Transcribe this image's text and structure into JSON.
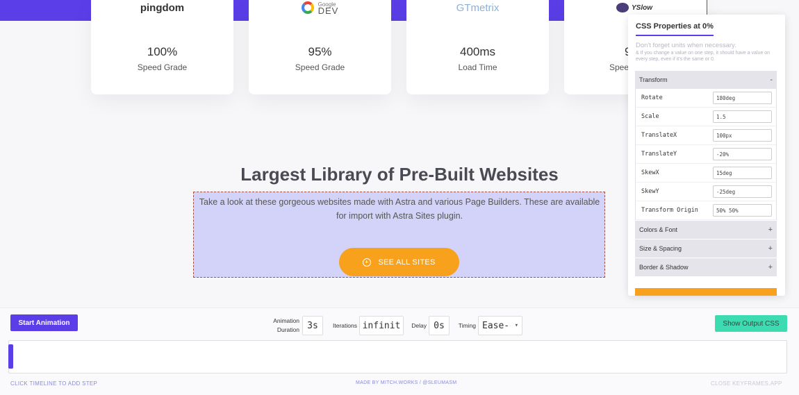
{
  "cards": [
    {
      "logo": "pingdom",
      "value": "100%",
      "label": "Speed Grade"
    },
    {
      "logo_small": "Google",
      "logo": "DEV",
      "value": "95%",
      "label": "Speed Grade"
    },
    {
      "logo": "GTmetrix",
      "value": "400ms",
      "label": "Load Time"
    },
    {
      "logo": "YSlow",
      "value": "9",
      "label": "Spee"
    }
  ],
  "section": {
    "title": "Largest Library of Pre-Built Websites",
    "description": "Take a look at these gorgeous websites made with Astra and various Page Builders. These are available for import with Astra Sites plugin.",
    "button_label": "SEE ALL SITES"
  },
  "panel": {
    "title": "CSS Properties at 0%",
    "hint": "Don't forget units when necessary.",
    "note": "& If you change a value on one step, it should have a value on every step, even if it's the same or 0.",
    "transform_header": "Transform",
    "transform_sign": "-",
    "properties": [
      {
        "name": "Rotate",
        "value": "180deg"
      },
      {
        "name": "Scale",
        "value": "1.5"
      },
      {
        "name": "TranslateX",
        "value": "100px"
      },
      {
        "name": "TranslateY",
        "value": "-20%"
      },
      {
        "name": "SkewX",
        "value": "15deg"
      },
      {
        "name": "SkewY",
        "value": "-25deg"
      },
      {
        "name": "Transform Origin",
        "value": "50% 50%"
      }
    ],
    "sections": [
      {
        "label": "Colors & Font",
        "sign": "+"
      },
      {
        "label": "Size & Spacing",
        "sign": "+"
      },
      {
        "label": "Border & Shadow",
        "sign": "+"
      }
    ]
  },
  "controls": {
    "start_label": "Start Animation",
    "duration_label_1": "Animation",
    "duration_label_2": "Duration",
    "duration_value": "3s",
    "iterations_label": "Iterations",
    "iterations_value": "infinit",
    "delay_label": "Delay",
    "delay_value": "0s",
    "timing_label": "Timing",
    "timing_value": "Ease-",
    "show_output_label": "Show Output CSS"
  },
  "footer": {
    "left": "CLICK TIMELINE TO ADD STEP",
    "middle": "MADE BY MITCH.WORKS / @SLEUMASM",
    "right": "CLOSE KEYFRAMES.APP"
  },
  "colors": {
    "accent": "#5b3ee8",
    "orange": "#f7a11d",
    "teal": "#3ddbb0",
    "highlight": "#d3d3f9"
  }
}
